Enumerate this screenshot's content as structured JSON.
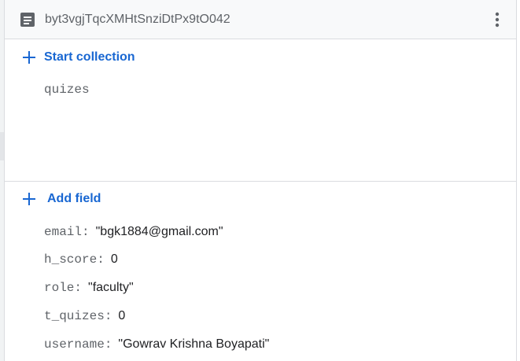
{
  "document": {
    "id": "byt3vgjTqcXMHtSnziDtPx9tO042",
    "icon": "document-icon",
    "menu_icon": "more-vert-icon"
  },
  "collections": {
    "start_label": "Start collection",
    "items": [
      "quizes"
    ]
  },
  "fields": {
    "add_label": "Add field",
    "items": [
      {
        "key": "email",
        "value": "\"bgk1884@gmail.com\""
      },
      {
        "key": "h_score",
        "value": "0"
      },
      {
        "key": "role",
        "value": "\"faculty\""
      },
      {
        "key": "t_quizes",
        "value": "0"
      },
      {
        "key": "username",
        "value": "\"Gowrav Krishna Boyapati\""
      }
    ]
  },
  "colors": {
    "accent": "#1967d2",
    "muted_text": "#5f6368",
    "header_bg": "#f8f9fa",
    "divider": "#dadce0"
  }
}
